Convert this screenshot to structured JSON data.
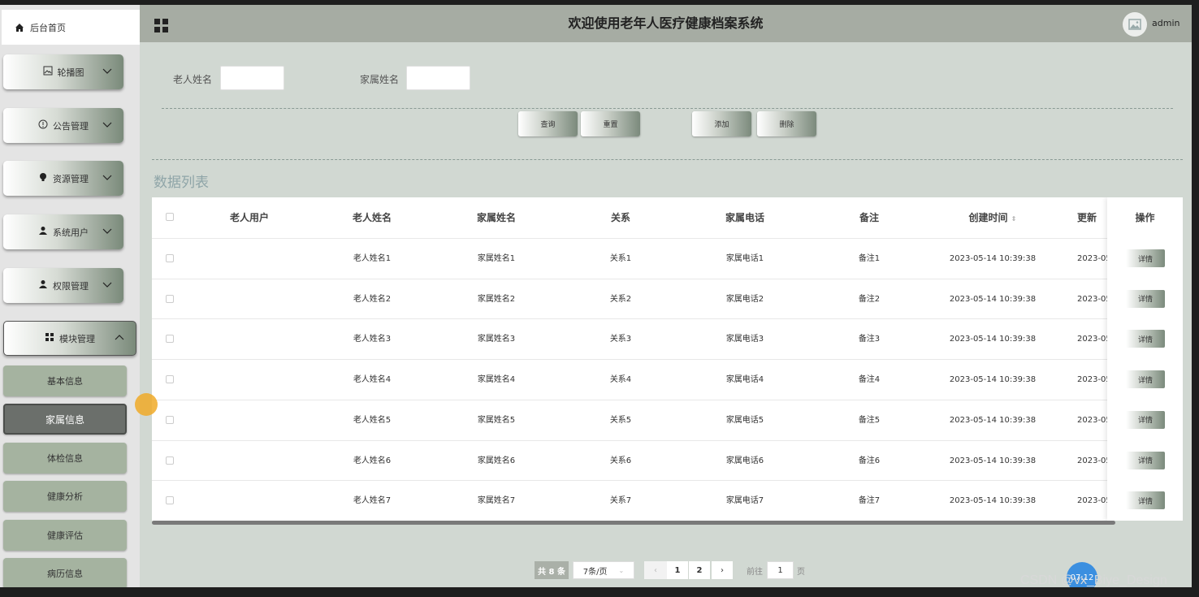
{
  "sidebar": {
    "home": "后台首页",
    "menus": [
      {
        "label": "轮播图",
        "icon": "image-icon"
      },
      {
        "label": "公告管理",
        "icon": "info-circle-icon"
      },
      {
        "label": "资源管理",
        "icon": "bulb-icon"
      },
      {
        "label": "系统用户",
        "icon": "user-icon"
      },
      {
        "label": "权限管理",
        "icon": "user-icon"
      },
      {
        "label": "模块管理",
        "icon": "grid-icon",
        "open": true
      }
    ],
    "submenus": [
      "基本信息",
      "家属信息",
      "体检信息",
      "健康分析",
      "健康评估",
      "病历信息"
    ],
    "active_submenu": "家属信息"
  },
  "header": {
    "title": "欢迎使用老年人医疗健康档案系统",
    "username": "admin"
  },
  "search": {
    "elder_name_label": "老人姓名",
    "family_name_label": "家属姓名",
    "elder_name_value": "",
    "family_name_value": ""
  },
  "actions": {
    "query": "查询",
    "reset": "重置",
    "add": "添加",
    "delete": "删除"
  },
  "list_title": "数据列表",
  "table": {
    "headers": [
      "老人用户",
      "老人姓名",
      "家属姓名",
      "关系",
      "家属电话",
      "备注",
      "创建时间",
      "更新",
      "操作"
    ],
    "rows": [
      {
        "user": "",
        "elder": "老人姓名1",
        "family": "家属姓名1",
        "relation": "关系1",
        "phone": "家属电话1",
        "note": "备注1",
        "created": "2023-05-14 10:39:38",
        "updated": "2023-05"
      },
      {
        "user": "",
        "elder": "老人姓名2",
        "family": "家属姓名2",
        "relation": "关系2",
        "phone": "家属电话2",
        "note": "备注2",
        "created": "2023-05-14 10:39:38",
        "updated": "2023-05"
      },
      {
        "user": "",
        "elder": "老人姓名3",
        "family": "家属姓名3",
        "relation": "关系3",
        "phone": "家属电话3",
        "note": "备注3",
        "created": "2023-05-14 10:39:38",
        "updated": "2023-05"
      },
      {
        "user": "",
        "elder": "老人姓名4",
        "family": "家属姓名4",
        "relation": "关系4",
        "phone": "家属电话4",
        "note": "备注4",
        "created": "2023-05-14 10:39:38",
        "updated": "2023-05"
      },
      {
        "user": "",
        "elder": "老人姓名5",
        "family": "家属姓名5",
        "relation": "关系5",
        "phone": "家属电话5",
        "note": "备注5",
        "created": "2023-05-14 10:39:38",
        "updated": "2023-05"
      },
      {
        "user": "",
        "elder": "老人姓名6",
        "family": "家属姓名6",
        "relation": "关系6",
        "phone": "家属电话6",
        "note": "备注6",
        "created": "2023-05-14 10:39:38",
        "updated": "2023-05"
      },
      {
        "user": "",
        "elder": "老人姓名7",
        "family": "家属姓名7",
        "relation": "关系7",
        "phone": "家属电话7",
        "note": "备注7",
        "created": "2023-05-14 10:39:38",
        "updated": "2023-05"
      }
    ],
    "detail_label": "详情"
  },
  "pagination": {
    "total": "共 8 条",
    "page_size": "7条/页",
    "pages": [
      "1",
      "2"
    ],
    "current": "1",
    "goto_prefix": "前往",
    "goto_value": "1",
    "goto_suffix": "页"
  },
  "overlay": {
    "clock": "07:12",
    "watermark": "CSDN @vx_Biye_Design"
  }
}
